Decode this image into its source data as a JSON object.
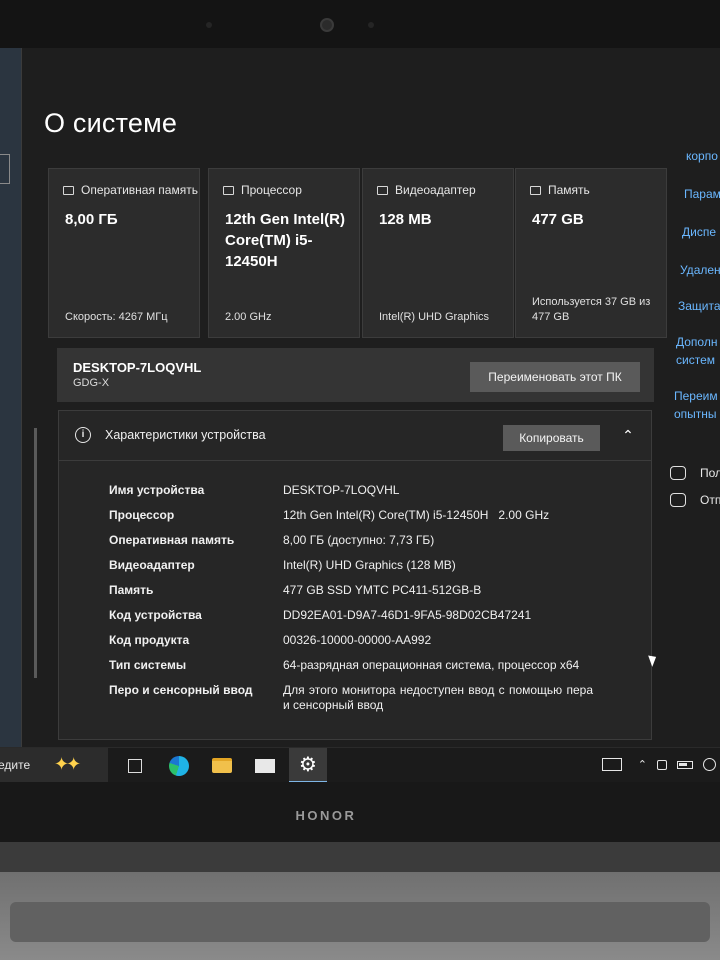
{
  "device": {
    "brand": "HONOR"
  },
  "page": {
    "title": "О системе"
  },
  "cards": [
    {
      "icon": "memory-icon",
      "label": "Оперативная память",
      "value": "8,00 ГБ",
      "foot": "Скорость: 4267 МГц"
    },
    {
      "icon": "processor-icon",
      "label": "Процессор",
      "value": "12th Gen Intel(R) Core(TM) i5-12450H",
      "foot": "2.00 GHz"
    },
    {
      "icon": "graphics-icon",
      "label": "Видеоадаптер",
      "value": "128 MB",
      "foot": "Intel(R) UHD Graphics"
    },
    {
      "icon": "storage-icon",
      "label": "Память",
      "value": "477 GB",
      "foot": "Используется 37 GB из 477 GB"
    }
  ],
  "pc": {
    "name": "DESKTOP-7LOQVHL",
    "workgroup": "GDG-X",
    "rename_label": "Переименовать этот ПК"
  },
  "specs": {
    "title": "Характеристики устройства",
    "copy_label": "Копировать",
    "rows": [
      {
        "label": "Имя устройства",
        "value": "DESKTOP-7LOQVHL"
      },
      {
        "label": "Процессор",
        "value": "12th Gen Intel(R) Core(TM) i5-12450H   2.00 GHz"
      },
      {
        "label": "Оперативная память",
        "value": "8,00 ГБ (доступно: 7,73 ГБ)"
      },
      {
        "label": "Видеоадаптер",
        "value": "Intel(R) UHD Graphics (128 MB)"
      },
      {
        "label": "Память",
        "value": "477 GB SSD YMTC PC411-512GB-B"
      },
      {
        "label": "Код устройства",
        "value": "DD92EA01-D9A7-46D1-9FA5-98D02CB47241"
      },
      {
        "label": "Код продукта",
        "value": "00326-10000-00000-AA992"
      },
      {
        "label": "Тип системы",
        "value": "64-разрядная операционная система, процессор x64"
      },
      {
        "label": "Перо и сенсорный ввод",
        "value": "Для этого монитора недоступен ввод с помощью пера и сенсорный ввод"
      }
    ]
  },
  "right_links": [
    "корпо",
    "Парам",
    "Диспе",
    "Удален",
    "Защита",
    "Дополн",
    "систем",
    "Переим",
    "опытны"
  ],
  "right_actions": [
    {
      "icon": "help-icon",
      "label": "Пол"
    },
    {
      "icon": "feedback-icon",
      "label": "Отп"
    }
  ],
  "taskbar": {
    "search_text": "едите"
  }
}
